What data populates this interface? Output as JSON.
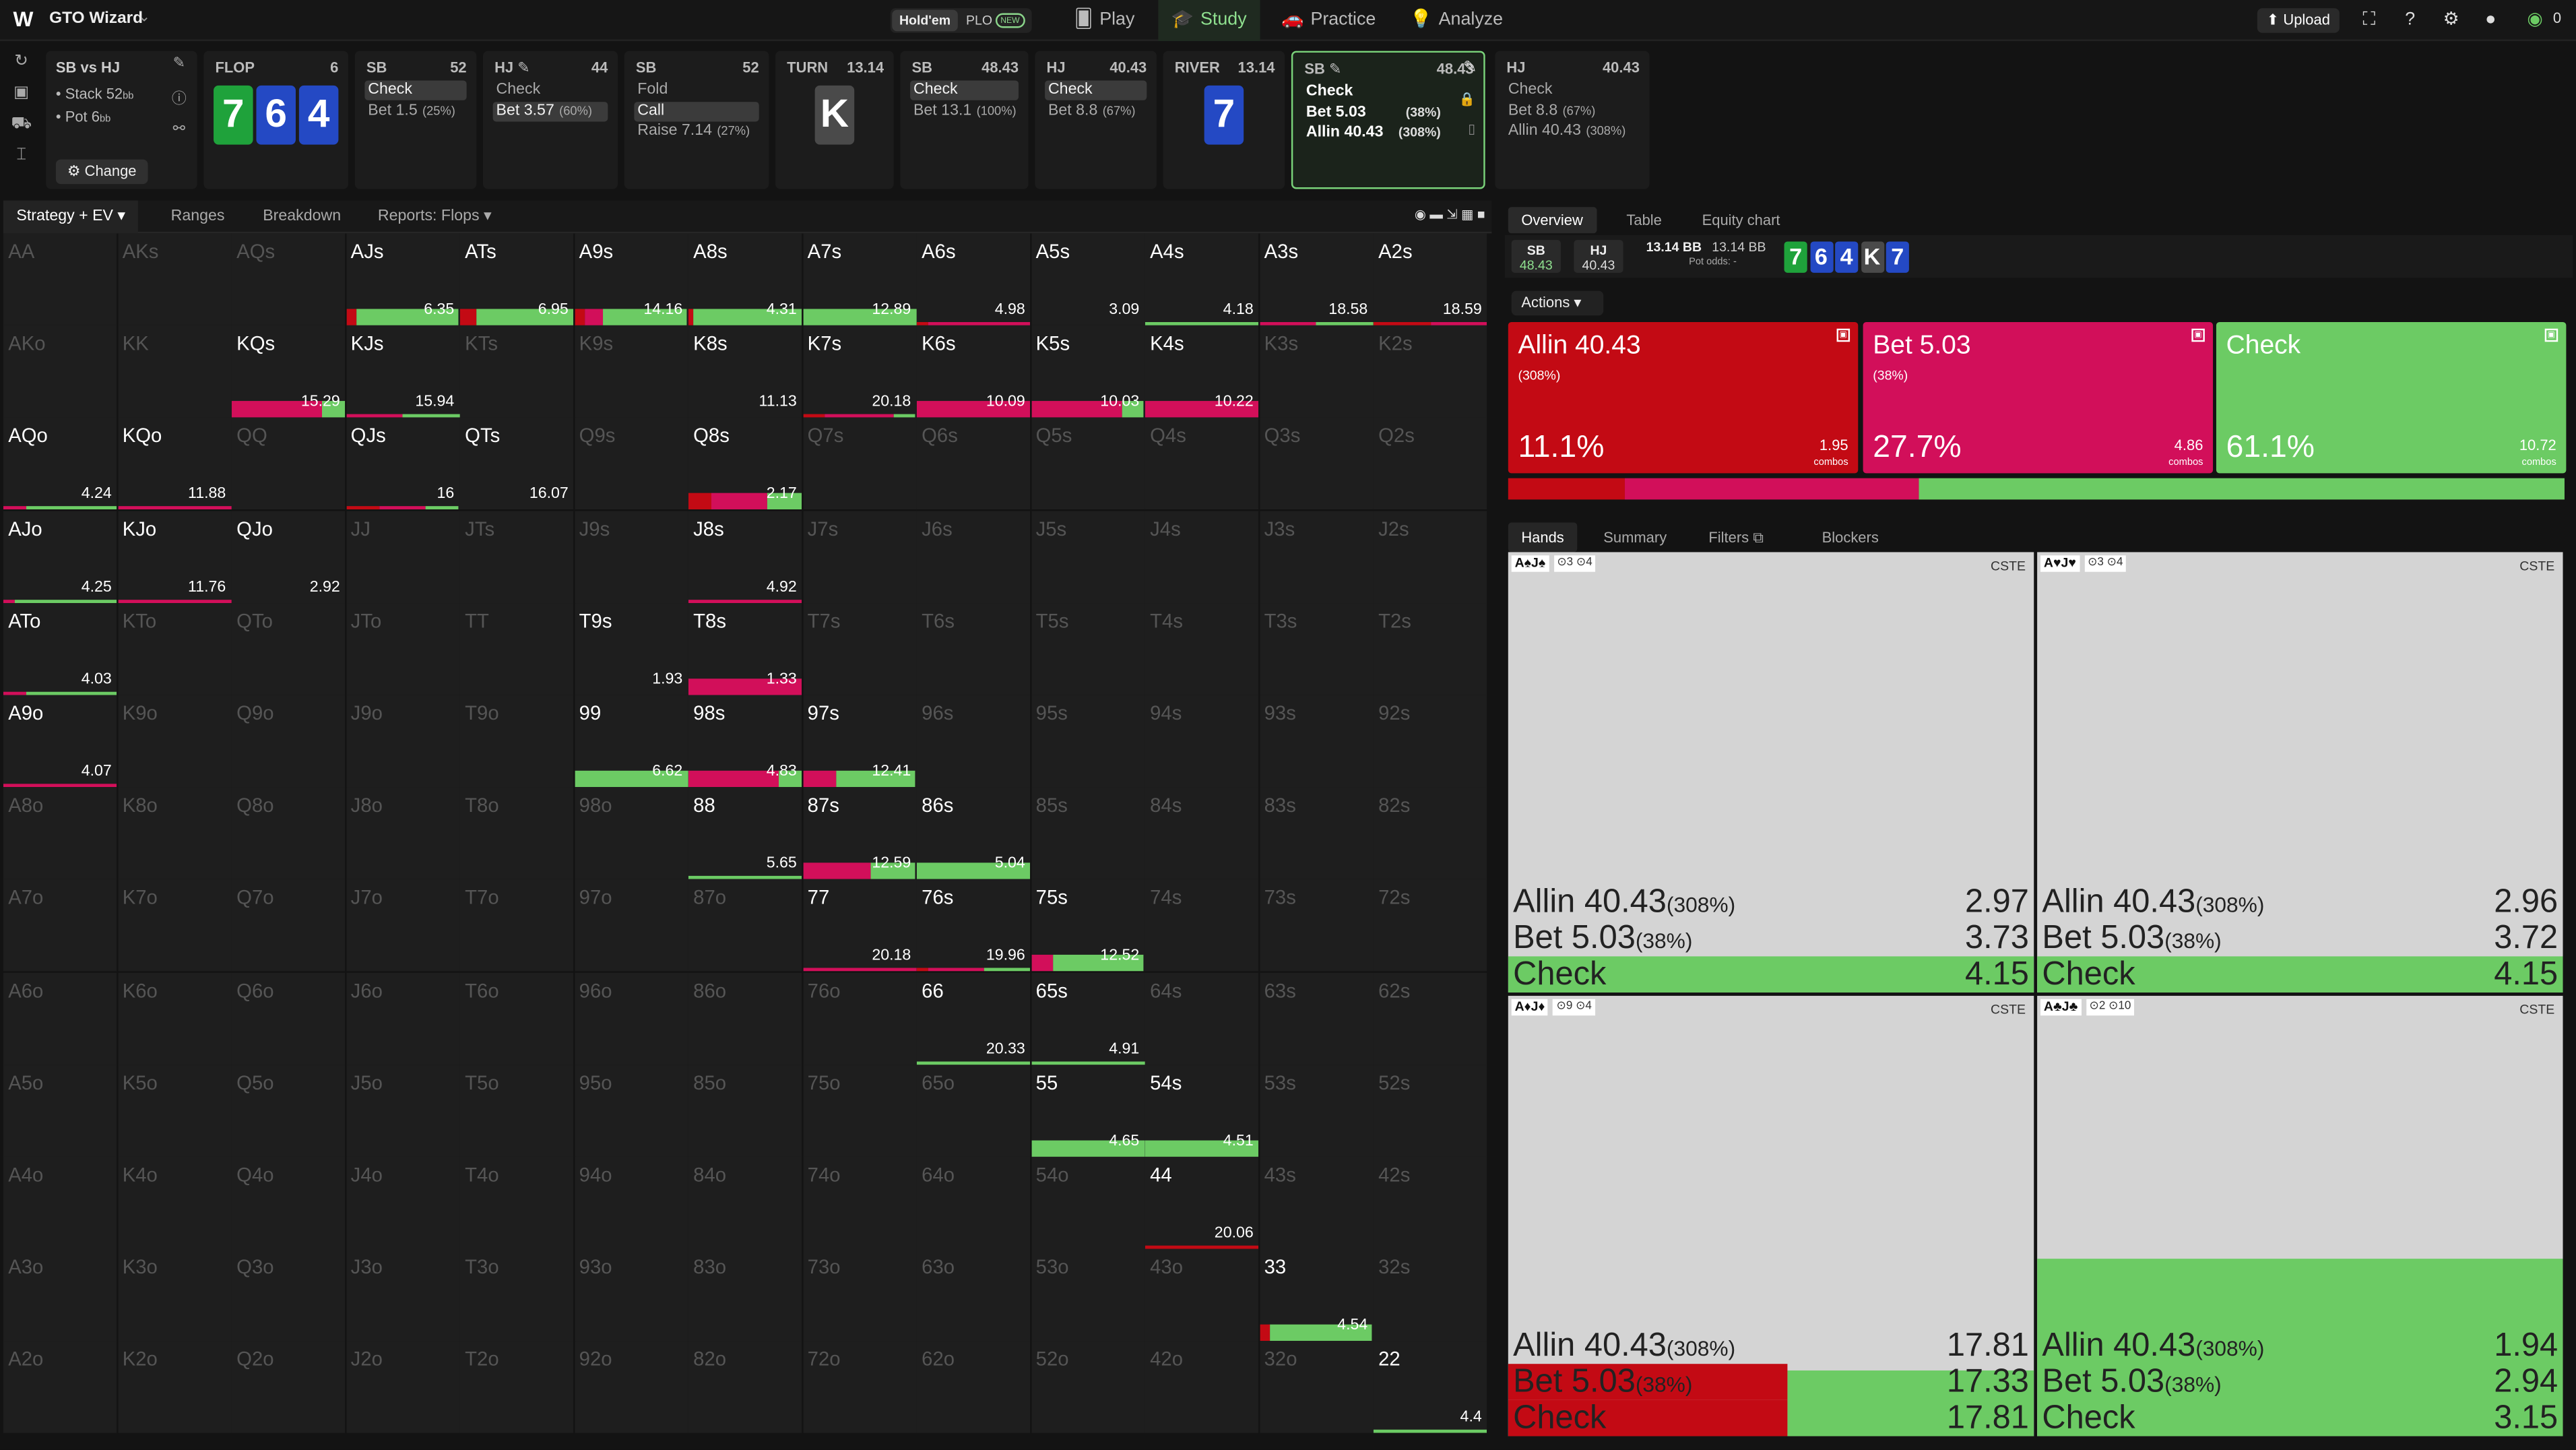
{
  "app": {
    "logo": "W",
    "name": "GTO Wizard",
    "game_holdem": "Hold'em",
    "game_plo": "PLO",
    "new_badge": "NEW",
    "nav": [
      {
        "label": "Play",
        "icon": "🂠"
      },
      {
        "label": "Study",
        "icon": "🎓"
      },
      {
        "label": "Practice",
        "icon": "🚗"
      },
      {
        "label": "Analyze",
        "icon": "💡"
      }
    ],
    "upload": "⬆ Upload",
    "coins": "0"
  },
  "colors": {
    "allin": "#c30a14",
    "bet": "#d20f5a",
    "check": "#6ccb64",
    "panel": "#1e1e1e"
  },
  "scenario": {
    "title": "SB vs HJ",
    "stack": "• Stack 52",
    "stack_unit": "bb",
    "pot": "• Pot 6",
    "pot_unit": "bb",
    "change": "⚙ Change"
  },
  "columns": [
    {
      "pos": "FLOP",
      "stk": "6",
      "cards": [
        {
          "r": "7",
          "c": "g"
        },
        {
          "r": "6",
          "c": "b"
        },
        {
          "r": "4",
          "c": "b"
        }
      ],
      "opts": []
    },
    {
      "pos": "SB",
      "stk": "52",
      "opts": [
        {
          "t": "Check",
          "sel": true
        },
        {
          "t": "Bet 1.5",
          "p": "(25%)"
        }
      ]
    },
    {
      "pos": "HJ ✎",
      "stk": "44",
      "opts": [
        {
          "t": "Check"
        },
        {
          "t": "Bet 3.57",
          "p": "(60%)",
          "sel": true
        }
      ]
    },
    {
      "pos": "SB",
      "stk": "52",
      "opts": [
        {
          "t": "Fold"
        },
        {
          "t": "Call",
          "sel": true
        },
        {
          "t": "Raise 7.14",
          "p": "(27%)"
        }
      ]
    },
    {
      "pos": "TURN",
      "stk": "13.14",
      "cards": [
        {
          "r": "K",
          "c": "k"
        }
      ],
      "opts": []
    },
    {
      "pos": "SB",
      "stk": "48.43",
      "opts": [
        {
          "t": "Check",
          "sel": true
        },
        {
          "t": "Bet 13.1",
          "p": "(100%)"
        }
      ]
    },
    {
      "pos": "HJ",
      "stk": "40.43",
      "opts": [
        {
          "t": "Check",
          "sel": true
        },
        {
          "t": "Bet 8.8",
          "p": "(67%)"
        }
      ]
    },
    {
      "pos": "RIVER",
      "stk": "13.14",
      "cards": [
        {
          "r": "7",
          "c": "b"
        }
      ],
      "opts": []
    },
    {
      "pos": "SB ✎",
      "stk": "48.43",
      "opts": [
        {
          "t": "Check",
          "ac": true
        },
        {
          "t": "Bet 5.03",
          "p": "(38%)",
          "ac": true
        },
        {
          "t": "Allin 40.43",
          "p": "(308%)",
          "ac": true
        }
      ]
    },
    {
      "pos": "HJ",
      "stk": "40.43",
      "opts": [
        {
          "t": "Check"
        },
        {
          "t": "Bet 8.8",
          "p": "(67%)"
        },
        {
          "t": "Allin 40.43",
          "p": "(308%)"
        }
      ]
    }
  ],
  "left_tabs": [
    "Strategy + EV ▾",
    "Ranges",
    "Breakdown",
    "Reports: Flops ▾"
  ],
  "grid": {
    "ranks": [
      "A",
      "K",
      "Q",
      "J",
      "T",
      "9",
      "8",
      "7",
      "6",
      "5",
      "4",
      "3",
      "2"
    ],
    "cells": {
      "AJs": {
        "ev": "6.35",
        "r": 0.1,
        "m": 0,
        "g": 0.9
      },
      "ATs": {
        "ev": "6.95",
        "r": 0.15,
        "m": 0,
        "g": 0.85
      },
      "A9s": {
        "ev": "14.16",
        "r": 0.1,
        "m": 0.15,
        "g": 0.75
      },
      "A8s": {
        "ev": "4.31",
        "r": 0.05,
        "m": 0,
        "g": 0.95
      },
      "A7s": {
        "ev": "12.89",
        "r": 0,
        "m": 0,
        "g": 1
      },
      "A6s": {
        "ev": "4.98",
        "r": 0.1,
        "m": 0.9,
        "g": 0,
        "thin": true
      },
      "A5s": {
        "ev": "3.09"
      },
      "A4s": {
        "ev": "4.18",
        "r": 0,
        "m": 0,
        "g": 1,
        "thin": true
      },
      "A3s": {
        "ev": "18.58",
        "r": 0,
        "m": 0.5,
        "g": 0.5,
        "thin": true
      },
      "A2s": {
        "ev": "18.59",
        "r": 0.5,
        "m": 0.5,
        "g": 0,
        "thin": true
      },
      "KQs": {
        "ev": "15.29",
        "r": 0,
        "m": 0.8,
        "g": 0.2
      },
      "KJs": {
        "ev": "15.94",
        "r": 0,
        "m": 0.5,
        "g": 0.5,
        "thin": true
      },
      "K8s": {
        "ev": "11.13"
      },
      "K7s": {
        "ev": "20.18",
        "r": 0.2,
        "m": 0.6,
        "g": 0.2,
        "thin": true
      },
      "K6s": {
        "ev": "10.09",
        "r": 0,
        "m": 1,
        "g": 0
      },
      "K5s": {
        "ev": "10.03",
        "r": 0,
        "m": 0.8,
        "g": 0.2
      },
      "K4s": {
        "ev": "10.22",
        "r": 0,
        "m": 1,
        "g": 0
      },
      "AQo": {
        "ev": "4.24",
        "r": 0,
        "m": 0.2,
        "g": 0.8,
        "thin": true
      },
      "KQo": {
        "ev": "11.88",
        "r": 0,
        "m": 1,
        "g": 0,
        "thin": true
      },
      "QJs": {
        "ev": "16",
        "r": 0.3,
        "m": 0.4,
        "g": 0.3,
        "thin": true
      },
      "QTs": {
        "ev": "16.07"
      },
      "Q8s": {
        "ev": "2.17",
        "r": 0.2,
        "m": 0.5,
        "g": 0.3
      },
      "AJo": {
        "ev": "4.25",
        "r": 0,
        "m": 0.1,
        "g": 0.9,
        "thin": true
      },
      "KJo": {
        "ev": "11.76",
        "r": 0,
        "m": 1,
        "g": 0,
        "thin": true
      },
      "QJo": {
        "ev": "2.92"
      },
      "J8s": {
        "ev": "4.92",
        "r": 0,
        "m": 1,
        "g": 0,
        "thin": true
      },
      "ATo": {
        "ev": "4.03",
        "r": 0,
        "m": 0.2,
        "g": 0.8,
        "thin": true
      },
      "T9s": {
        "ev": "1.93"
      },
      "T8s": {
        "ev": "1.33",
        "r": 0,
        "m": 1,
        "g": 0
      },
      "A9o": {
        "ev": "4.07",
        "r": 0,
        "m": 1,
        "g": 0,
        "thin": true
      },
      "99": {
        "ev": "6.62",
        "r": 0,
        "m": 0,
        "g": 1
      },
      "98s": {
        "ev": "4.83",
        "r": 0,
        "m": 0.8,
        "g": 0.2
      },
      "97s": {
        "ev": "12.41",
        "r": 0,
        "m": 0.3,
        "g": 0.7
      },
      "88": {
        "ev": "5.65",
        "r": 0,
        "m": 0,
        "g": 1,
        "thin": true
      },
      "87s": {
        "ev": "12.59",
        "r": 0,
        "m": 0.6,
        "g": 0.4
      },
      "86s": {
        "ev": "5.04",
        "r": 0,
        "m": 0,
        "g": 1
      },
      "77": {
        "ev": "20.18",
        "r": 0,
        "m": 1,
        "g": 0,
        "thin": true
      },
      "76s": {
        "ev": "19.96",
        "r": 0.1,
        "m": 0.5,
        "g": 0.4,
        "thin": true
      },
      "75s": {
        "ev": "12.52",
        "r": 0,
        "m": 0.2,
        "g": 0.8
      },
      "66": {
        "ev": "20.33",
        "r": 0,
        "m": 0,
        "g": 1,
        "thin": true
      },
      "65s": {
        "ev": "4.91",
        "r": 0,
        "m": 0,
        "g": 1,
        "thin": true
      },
      "55": {
        "ev": "4.65",
        "r": 0,
        "m": 0,
        "g": 1
      },
      "54s": {
        "ev": "4.51",
        "r": 0,
        "m": 0,
        "g": 1
      },
      "44": {
        "ev": "20.06",
        "r": 1,
        "m": 0,
        "g": 0,
        "thin": true
      },
      "33": {
        "ev": "4.54",
        "r": 0.1,
        "m": 0,
        "g": 0.9
      },
      "22": {
        "ev": "4.4",
        "r": 0,
        "m": 0,
        "g": 1,
        "thin": true
      }
    }
  },
  "right_tabs": [
    "Overview",
    "Table",
    "Equity chart"
  ],
  "infobar": {
    "sb": "SB",
    "sb_stk": "48.43",
    "hj": "HJ",
    "hj_stk": "40.43",
    "pot": "13.14 BB",
    "pot2": "13.14 BB",
    "pot_odds": "Pot odds: -",
    "board": [
      {
        "r": "7",
        "c": "#1fa23b"
      },
      {
        "r": "6",
        "c": "#2449c4"
      },
      {
        "r": "4",
        "c": "#2449c4"
      },
      {
        "r": "K",
        "c": "#4a4a4a"
      },
      {
        "r": "7",
        "c": "#2449c4"
      }
    ]
  },
  "actions_label": "Actions ▾",
  "actions": [
    {
      "t": "Allin 40.43",
      "s": "(308%)",
      "p": "11.1%",
      "c": "1.95",
      "cl": "combos",
      "freq": 0.111,
      "color": "#c30a14"
    },
    {
      "t": "Bet 5.03",
      "s": "(38%)",
      "p": "27.7%",
      "c": "4.86",
      "cl": "combos",
      "freq": 0.277,
      "color": "#d20f5a"
    },
    {
      "t": "Check",
      "s": "",
      "p": "61.1%",
      "c": "10.72",
      "cl": "combos",
      "freq": 0.611,
      "color": "#6ccb64"
    }
  ],
  "hand_tabs": [
    "Hands",
    "Summary",
    "Filters ⧉",
    "Blockers"
  ],
  "hands": [
    {
      "hand": "A♠J♠",
      "b1": "3",
      "b2": "4",
      "cs": "CSTE",
      "rows": [
        {
          "n": "Allin 40.43",
          "s": "(308%)",
          "v": "2.97",
          "f": 0
        },
        {
          "n": "Bet 5.03",
          "s": "(38%)",
          "v": "3.73",
          "f": 0
        },
        {
          "n": "Check",
          "s": "",
          "v": "4.15",
          "f": 1,
          "fc": "#6ccb64"
        }
      ]
    },
    {
      "hand": "A♥J♥",
      "b1": "3",
      "b2": "4",
      "cs": "CSTE",
      "rows": [
        {
          "n": "Allin 40.43",
          "s": "(308%)",
          "v": "2.96",
          "f": 0
        },
        {
          "n": "Bet 5.03",
          "s": "(38%)",
          "v": "3.72",
          "f": 0
        },
        {
          "n": "Check",
          "s": "",
          "v": "4.15",
          "f": 1,
          "fc": "#6ccb64"
        }
      ]
    },
    {
      "hand": "A♦J♦",
      "b1": "9",
      "b2": "4",
      "cs": "CSTE",
      "rows": [
        {
          "n": "Allin 40.43",
          "s": "(308%)",
          "v": "17.81",
          "f": 0
        },
        {
          "n": "Bet 5.03",
          "s": "(38%)",
          "v": "17.33",
          "f": 0.53,
          "fc": "#c30a14"
        },
        {
          "n": "Check",
          "s": "",
          "v": "17.81",
          "f": 0.53,
          "fc": "#c30a14"
        }
      ],
      "fillrest": "#6ccb64"
    },
    {
      "hand": "A♣J♣",
      "b1": "2",
      "b2": "10",
      "cs": "CSTE",
      "rows": [
        {
          "n": "Allin 40.43",
          "s": "(308%)",
          "v": "1.94",
          "f": 1,
          "fc": "#6ccb64"
        },
        {
          "n": "Bet 5.03",
          "s": "(38%)",
          "v": "2.94",
          "f": 1,
          "fc": "#6ccb64"
        },
        {
          "n": "Check",
          "s": "",
          "v": "3.15",
          "f": 1,
          "fc": "#6ccb64"
        }
      ],
      "topfill": true
    }
  ]
}
